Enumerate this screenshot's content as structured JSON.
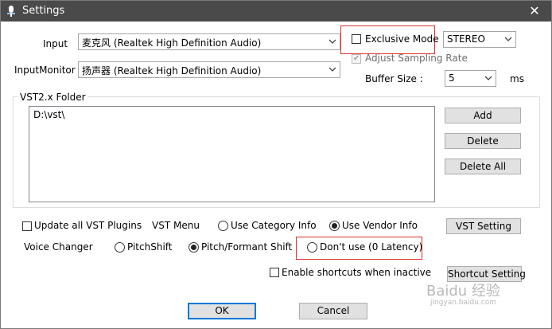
{
  "window": {
    "title": "Settings",
    "close_glyph": "✕"
  },
  "audio": {
    "input_label": "Input",
    "input_value": "麦克风 (Realtek High Definition Audio)",
    "input_monitor_label": "InputMonitor",
    "input_monitor_value": "扬声器 (Realtek High Definition Audio)",
    "exclusive_mode_label": "Exclusive Mode",
    "exclusive_mode_checked": false,
    "channel_value": "STEREO",
    "adjust_sampling_label": "Adjust Sampling Rate",
    "adjust_sampling_checked": true,
    "buffer_size_label": "Buffer Size :",
    "buffer_size_value": "5",
    "buffer_unit": "ms"
  },
  "vst": {
    "folder_label": "VST2.x Folder",
    "folders": [
      "D:\\vst\\"
    ],
    "add_label": "Add",
    "delete_label": "Delete",
    "delete_all_label": "Delete All",
    "update_all_label": "Update all VST Plugins",
    "menu_label": "VST Menu",
    "category_label": "Use Category Info",
    "vendor_label": "Use Vendor Info",
    "menu_mode_selected": "vendor",
    "setting_label": "VST Setting"
  },
  "voice_changer": {
    "label": "Voice Changer",
    "pitchshift_label": "PitchShift",
    "pitch_formant_label": "Pitch/Formant Shift",
    "dont_use_label": "Don't use  (0 Latency)",
    "selected": "pitch_formant"
  },
  "shortcuts": {
    "inactive_label": "Enable shortcuts when inactive",
    "inactive_checked": false,
    "setting_label": "Shortcut Setting"
  },
  "footer": {
    "ok_label": "OK",
    "cancel_label": "Cancel"
  },
  "watermark": {
    "line1": "Baidu 经验",
    "line2": "jingyan.baidu.com"
  },
  "colors": {
    "titlebar": "#4a4a4a",
    "highlight": "#e03030",
    "focus": "#0078d7"
  }
}
